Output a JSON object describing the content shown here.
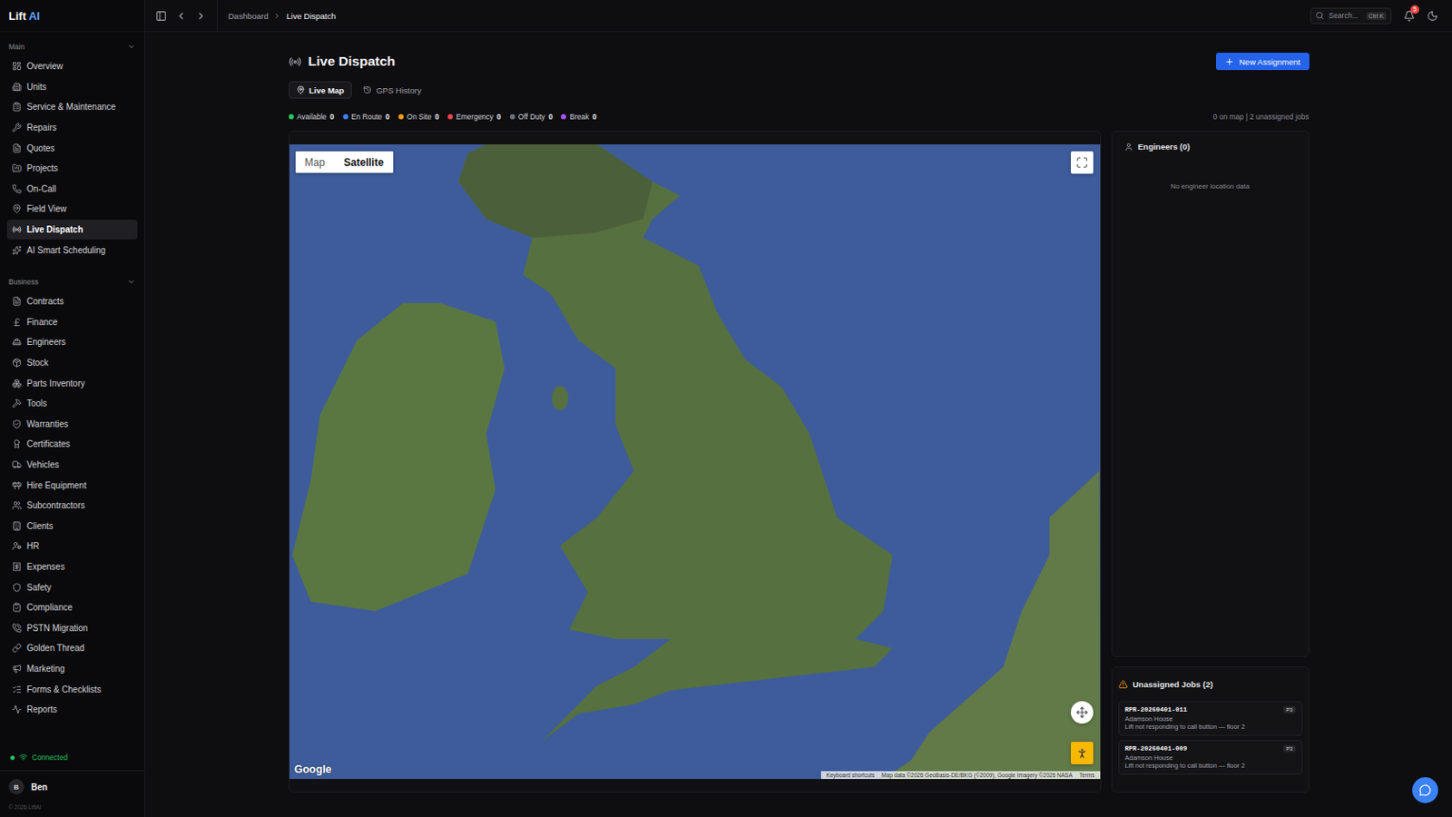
{
  "brand": {
    "name": "Lift",
    "accent": "AI"
  },
  "sidebar": {
    "sections": [
      {
        "title": "Main",
        "expanded": true,
        "items": [
          {
            "label": "Overview",
            "selected": false
          },
          {
            "label": "Units",
            "selected": false
          },
          {
            "label": "Service & Maintenance",
            "selected": false
          },
          {
            "label": "Repairs",
            "selected": false
          },
          {
            "label": "Quotes",
            "selected": false
          },
          {
            "label": "Projects",
            "selected": false
          },
          {
            "label": "On-Call",
            "selected": false
          },
          {
            "label": "Field View",
            "selected": false
          },
          {
            "label": "Live Dispatch",
            "selected": true
          },
          {
            "label": "AI Smart Scheduling",
            "selected": false
          }
        ]
      },
      {
        "title": "Business",
        "expanded": true,
        "items": [
          {
            "label": "Contracts",
            "selected": false
          },
          {
            "label": "Finance",
            "selected": false
          },
          {
            "label": "Engineers",
            "selected": false
          },
          {
            "label": "Stock",
            "selected": false
          },
          {
            "label": "Parts Inventory",
            "selected": false
          },
          {
            "label": "Tools",
            "selected": false
          },
          {
            "label": "Warranties",
            "selected": false
          },
          {
            "label": "Certificates",
            "selected": false
          },
          {
            "label": "Vehicles",
            "selected": false
          },
          {
            "label": "Hire Equipment",
            "selected": false
          },
          {
            "label": "Subcontractors",
            "selected": false
          },
          {
            "label": "Clients",
            "selected": false
          },
          {
            "label": "HR",
            "selected": false
          },
          {
            "label": "Expenses",
            "selected": false
          },
          {
            "label": "Safety",
            "selected": false
          },
          {
            "label": "Compliance",
            "selected": false
          },
          {
            "label": "PSTN Migration",
            "selected": false
          },
          {
            "label": "Golden Thread",
            "selected": false
          },
          {
            "label": "Marketing",
            "selected": false
          },
          {
            "label": "Forms & Checklists",
            "selected": false
          },
          {
            "label": "Reports",
            "selected": false
          }
        ]
      }
    ],
    "connection": {
      "label": "Connected",
      "on": true
    },
    "user": {
      "initial": "B",
      "name": "Ben"
    },
    "footer": "© 2026 LiftAI"
  },
  "topbar": {
    "breadcrumbs": [
      "Dashboard",
      "Live Dispatch"
    ],
    "search": {
      "placeholder": "Search...",
      "shortcut": "Ctrl K"
    },
    "notifications": "5"
  },
  "page": {
    "title": "Live Dispatch",
    "primary_button": "New Assignment"
  },
  "tabs": [
    {
      "label": "Live Map",
      "selected": true
    },
    {
      "label": "GPS History",
      "selected": false
    }
  ],
  "statuses": [
    {
      "label": "Available",
      "count": "0",
      "color": "#22c55e"
    },
    {
      "label": "En Route",
      "count": "0",
      "color": "#3b82f6"
    },
    {
      "label": "On Site",
      "count": "0",
      "color": "#f59e0b"
    },
    {
      "label": "Emergency",
      "count": "0",
      "color": "#ef4444"
    },
    {
      "label": "Off Duty",
      "count": "0",
      "color": "#6b7280"
    },
    {
      "label": "Break",
      "count": "0",
      "color": "#a855f7"
    }
  ],
  "summary": "0 on map | 2 unassigned jobs",
  "map": {
    "types": [
      {
        "label": "Map",
        "selected": false
      },
      {
        "label": "Satellite",
        "selected": true
      }
    ],
    "logo": "Google",
    "attribution": [
      "Keyboard shortcuts",
      "Map data ©2026 GeoBasis-DE/BKG (©2009), Google Imagery ©2026 NASA",
      "Terms"
    ]
  },
  "engineers": {
    "title": "Engineers (0)",
    "empty": "No engineer location data"
  },
  "unassigned": {
    "title": "Unassigned Jobs (2)",
    "jobs": [
      {
        "ref": "RPR-20260401-011",
        "priority": "P3",
        "site": "Adamson House",
        "issue": "Lift not responding to call button — floor 2"
      },
      {
        "ref": "RPR-20260401-009",
        "priority": "P3",
        "site": "Adamson House",
        "issue": "Lift not responding to call button — floor 2"
      }
    ]
  }
}
